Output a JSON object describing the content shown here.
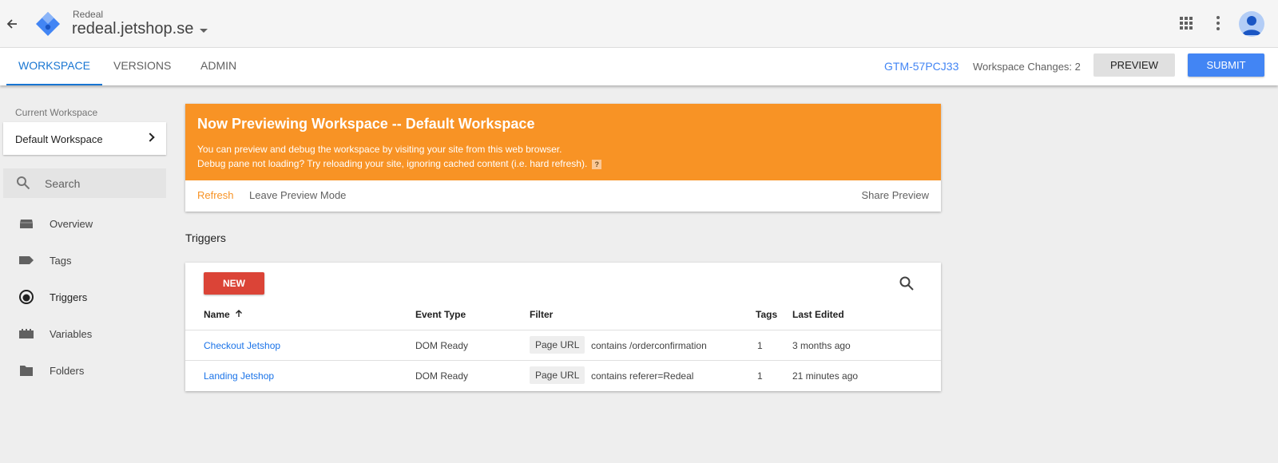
{
  "header": {
    "account": "Redeal",
    "container": "redeal.jetshop.se"
  },
  "tabs": [
    {
      "label": "WORKSPACE",
      "active": true
    },
    {
      "label": "VERSIONS",
      "active": false
    },
    {
      "label": "ADMIN",
      "active": false
    }
  ],
  "toolbar": {
    "container_id": "GTM-57PCJ33",
    "workspace_changes": "Workspace Changes: 2",
    "preview_label": "PREVIEW",
    "submit_label": "SUBMIT"
  },
  "sidebar": {
    "current_workspace_label": "Current Workspace",
    "current_workspace": "Default Workspace",
    "search_placeholder": "Search",
    "items": [
      {
        "label": "Overview",
        "icon": "overview-icon",
        "active": false
      },
      {
        "label": "Tags",
        "icon": "tag-icon",
        "active": false
      },
      {
        "label": "Triggers",
        "icon": "trigger-icon",
        "active": true
      },
      {
        "label": "Variables",
        "icon": "variables-icon",
        "active": false
      },
      {
        "label": "Folders",
        "icon": "folder-icon",
        "active": false
      }
    ]
  },
  "banner": {
    "title": "Now Previewing Workspace -- Default Workspace",
    "line1": "You can preview and debug the workspace by visiting your site from this web browser.",
    "line2": "Debug pane not loading? Try reloading your site, ignoring cached content (i.e. hard refresh).",
    "help": "?",
    "refresh": "Refresh",
    "leave": "Leave Preview Mode",
    "share": "Share Preview"
  },
  "triggers": {
    "section_title": "Triggers",
    "new_label": "NEW",
    "columns": {
      "name": "Name",
      "event_type": "Event Type",
      "filter": "Filter",
      "tags": "Tags",
      "last_edited": "Last Edited"
    },
    "rows": [
      {
        "name": "Checkout Jetshop",
        "event_type": "DOM Ready",
        "filter_var": "Page URL",
        "filter_expr": "contains /orderconfirmation",
        "tags": "1",
        "last_edited": "3 months ago"
      },
      {
        "name": "Landing Jetshop",
        "event_type": "DOM Ready",
        "filter_var": "Page URL",
        "filter_expr": "contains referer=Redeal",
        "tags": "1",
        "last_edited": "21 minutes ago"
      }
    ]
  },
  "colors": {
    "accent": "#1976d2",
    "banner": "#f89325",
    "new_button": "#db4437",
    "submit_button": "#4285f4"
  }
}
